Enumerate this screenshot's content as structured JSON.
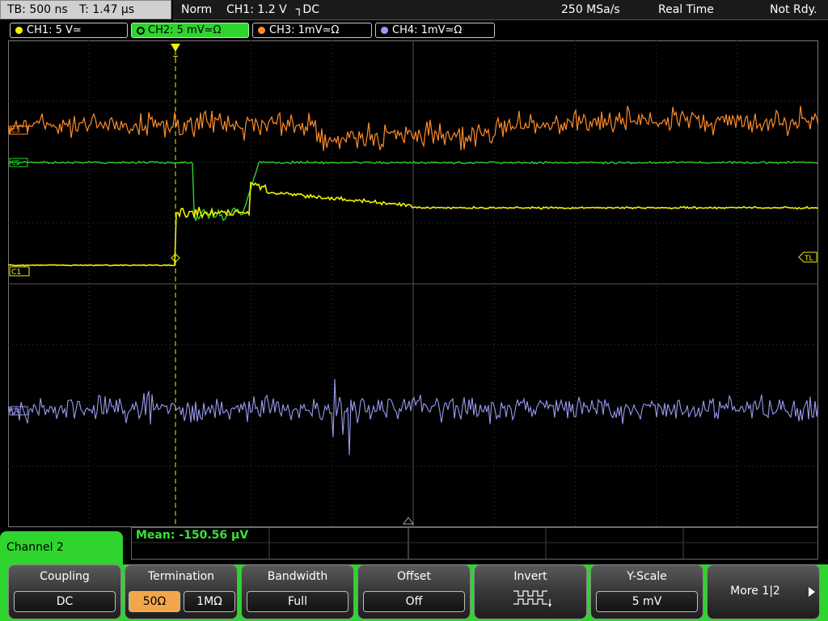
{
  "status": {
    "timebase": "TB: 500 ns",
    "trigger_time": "T: 1.47 µs",
    "mode": "Norm",
    "trigger_info": "CH1: 1.2 V",
    "trigger_slope_coupling": "┐DC",
    "sample_rate": "250 MSa/s",
    "acq_mode": "Real Time",
    "state": "Not Rdy."
  },
  "channels": [
    {
      "label": "CH1: 5 V≃",
      "color": "#f2f200"
    },
    {
      "label": "CH2: 5 mV≃Ω",
      "color": "#2fd42f"
    },
    {
      "label": "CH3: 1mV≃Ω",
      "color": "#ff8c2a"
    },
    {
      "label": "CH4: 1mV≃Ω",
      "color": "#9a9af0"
    }
  ],
  "markers": {
    "ch3": "C3",
    "ch2": "C2",
    "ch1": "C1",
    "ch4": "C4",
    "trigger_level": "TL",
    "trigger_pos": "T"
  },
  "measurement": {
    "text": "Mean: -150.56 µV"
  },
  "menu": {
    "title": "Channel 2",
    "coupling": {
      "label": "Coupling",
      "value": "DC"
    },
    "termination": {
      "label": "Termination",
      "option_a": "50Ω",
      "option_b": "1MΩ"
    },
    "bandwidth": {
      "label": "Bandwidth",
      "value": "Full"
    },
    "offset": {
      "label": "Offset",
      "value": "Off"
    },
    "invert": {
      "label": "Invert",
      "icon": "invert-wave-icon"
    },
    "yscale": {
      "label": "Y-Scale",
      "value": "5 mV"
    },
    "more": {
      "label": "More 1|2",
      "icon": "arrow-right-icon"
    }
  }
}
